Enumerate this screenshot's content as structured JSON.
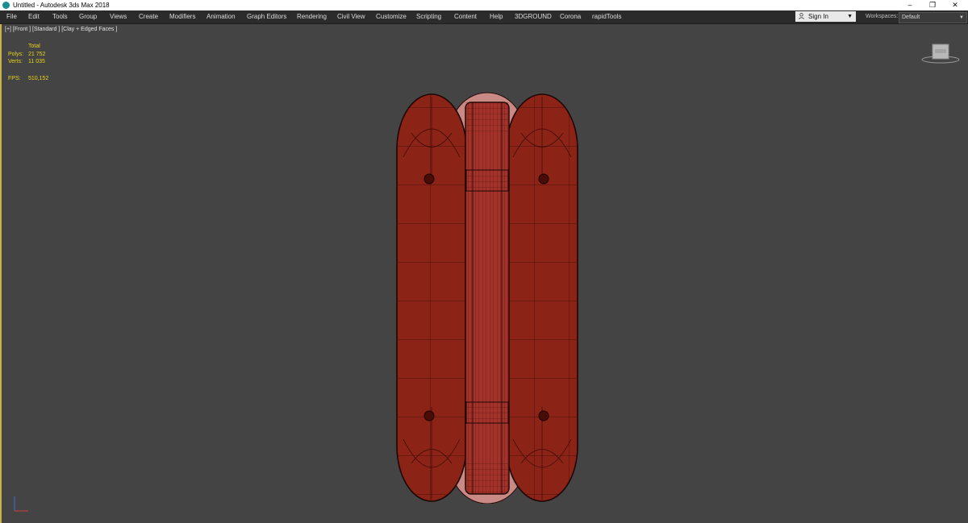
{
  "window": {
    "title": "Untitled - Autodesk 3ds Max 2018",
    "controls": {
      "minimize": "–",
      "maximize": "❐",
      "close": "✕"
    }
  },
  "menu": [
    "File",
    "Edit",
    "Tools",
    "Group",
    "Views",
    "Create",
    "Modifiers",
    "Animation",
    "Graph Editors",
    "Rendering",
    "Civil View",
    "Customize",
    "Scripting",
    "Content",
    "Help",
    "3DGROUND",
    "Corona",
    "rapidTools"
  ],
  "account": {
    "signin_label": "Sign In",
    "caret": "▼"
  },
  "workspaces": {
    "label": "Workspaces:",
    "value": "Default",
    "caret": "▼"
  },
  "viewport": {
    "label": "[+] [Front ] [Standard ] [Clay + Edged Faces ]",
    "stats": {
      "header": "Total",
      "polys_label": "Polys:",
      "polys_value": "21 752",
      "verts_label": "Verts:",
      "verts_value": "11 035",
      "fps_label": "FPS:",
      "fps_value": "510,152"
    }
  },
  "colors": {
    "viewport_bg": "#444444",
    "menu_bg": "#2b2b2b",
    "stat_text": "#e7d21a",
    "active_border": "#c8b34a",
    "model_red": "#8b2316",
    "model_pink": "#c98a86"
  },
  "icons": [
    "app-icon",
    "user-icon",
    "viewcube-icon",
    "axis-tripod-icon"
  ]
}
